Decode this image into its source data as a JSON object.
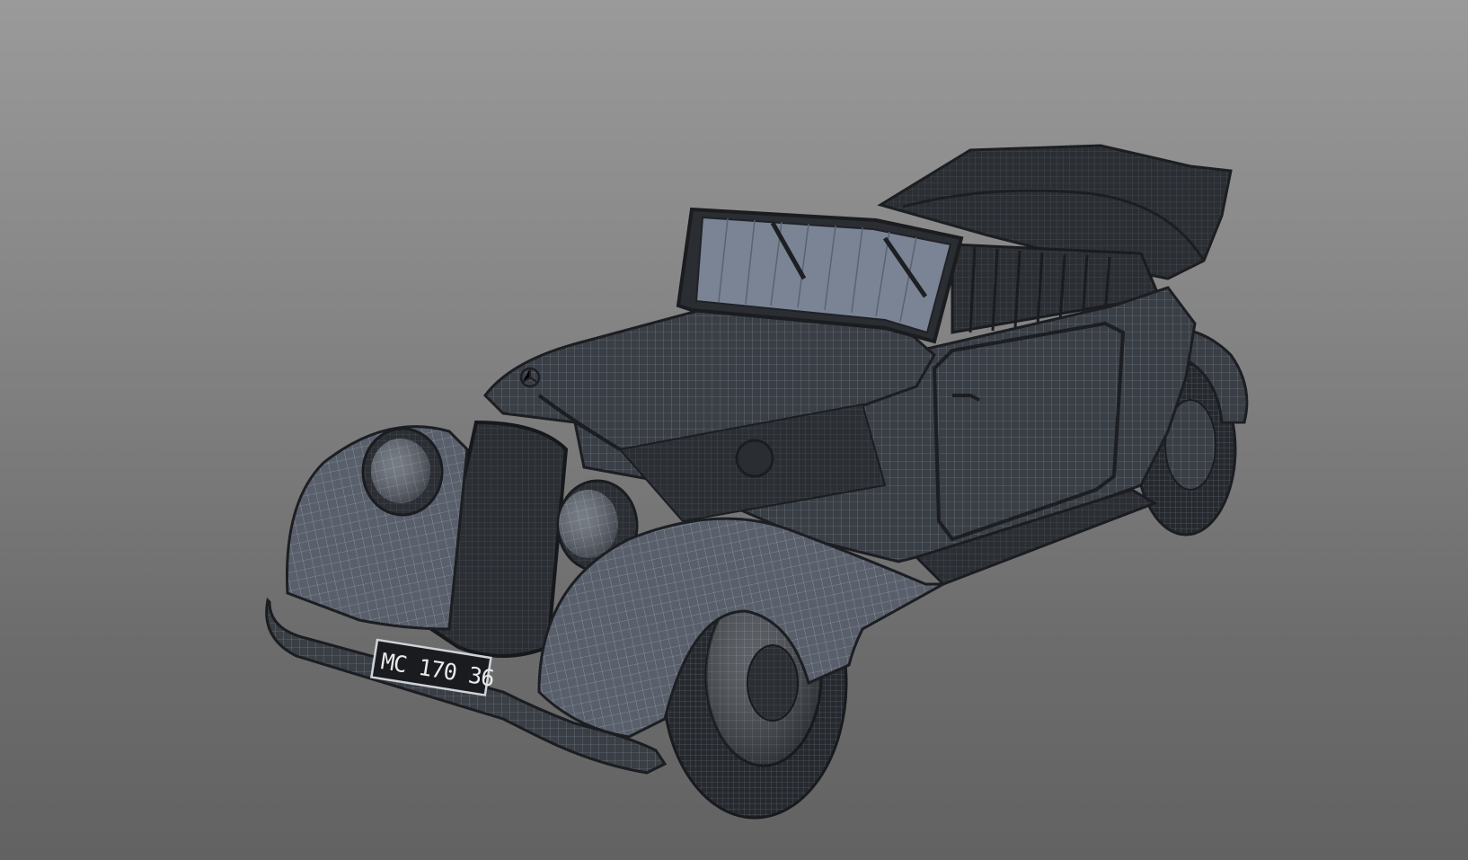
{
  "viewport": {
    "background_top": "#9a9a9a",
    "background_bottom": "#626262"
  },
  "model": {
    "description_icon": "car-3d-wireframe",
    "body_color": "#2e3137",
    "wire_color": "#8f97a3",
    "glass_color": "#7a8494",
    "license_plate": "MC 170 36"
  }
}
